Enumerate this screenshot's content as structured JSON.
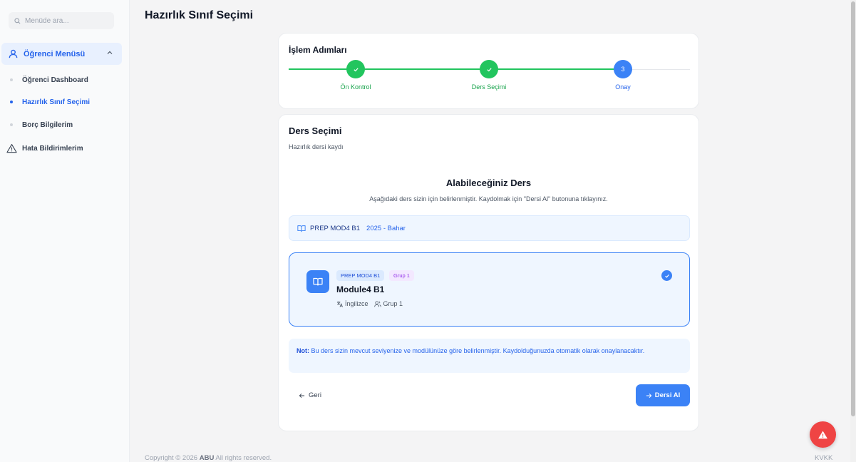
{
  "sidebar": {
    "search_placeholder": "Menüde ara...",
    "group_label": "Öğrenci Menüsü",
    "items": [
      {
        "label": "Öğrenci Dashboard"
      },
      {
        "label": "Hazırlık Sınıf Seçimi"
      },
      {
        "label": "Borç Bilgilerim"
      }
    ],
    "error_reports_label": "Hata Bildirimlerim"
  },
  "page": {
    "title": "Hazırlık Sınıf Seçimi"
  },
  "steps": {
    "title": "İşlem Adımları",
    "items": [
      {
        "label": "Ön Kontrol",
        "status": "done"
      },
      {
        "label": "Ders Seçimi",
        "status": "done"
      },
      {
        "label": "Onay",
        "status": "current",
        "number": "3"
      }
    ]
  },
  "selection": {
    "title": "Ders Seçimi",
    "subtitle": "Hazırlık dersi kaydı",
    "available_title": "Alabileceğiniz Ders",
    "available_desc": "Aşağıdaki ders sizin için belirlenmiştir. Kaydolmak için \"Dersi Al\" butonuna tıklayınız.",
    "info_code": "PREP MOD4 B1",
    "info_term": "2025 - Bahar",
    "course": {
      "code_badge": "PREP MOD4 B1",
      "group_badge": "Grup 1",
      "name": "Module4 B1",
      "language": "İngilizce",
      "group": "Grup 1"
    },
    "note_label": "Not:",
    "note_text": " Bu ders sizin mevcut seviyenize ve modülünüze göre belirlenmiştir. Kaydolduğunuzda otomatik olarak onaylanacaktır.",
    "back_label": "Geri",
    "take_label": "Dersi Al"
  },
  "footer": {
    "copyright_prefix": "Copyright © 2026 ",
    "brand": "ABU",
    "copyright_suffix": " All rights reserved.",
    "kvkk": "KVKK"
  },
  "colors": {
    "primary": "#3b82f6",
    "success": "#22c55e",
    "danger": "#ef4444"
  }
}
